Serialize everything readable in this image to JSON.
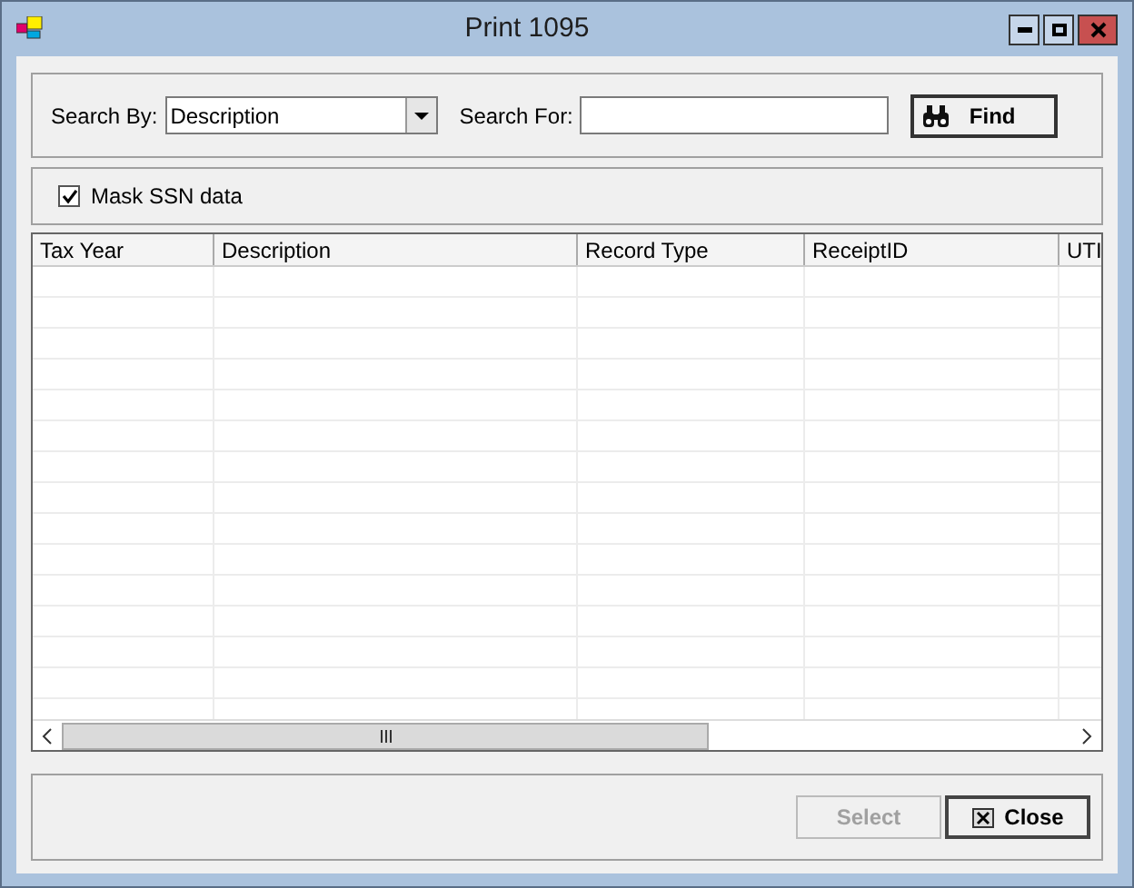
{
  "window": {
    "title": "Print 1095"
  },
  "search": {
    "by_label": "Search By:",
    "by_value": "Description",
    "for_label": "Search For:",
    "find_button": "Find"
  },
  "mask_ssn": {
    "label": "Mask SSN data",
    "checked": true
  },
  "table": {
    "columns": [
      "Tax Year",
      "Description",
      "Record Type",
      "ReceiptID",
      "UTI"
    ]
  },
  "buttons": [
    {
      "label": "Select",
      "disabled": true,
      "kind": "select"
    },
    {
      "label": "Close",
      "disabled": false,
      "kind": "close"
    }
  ]
}
